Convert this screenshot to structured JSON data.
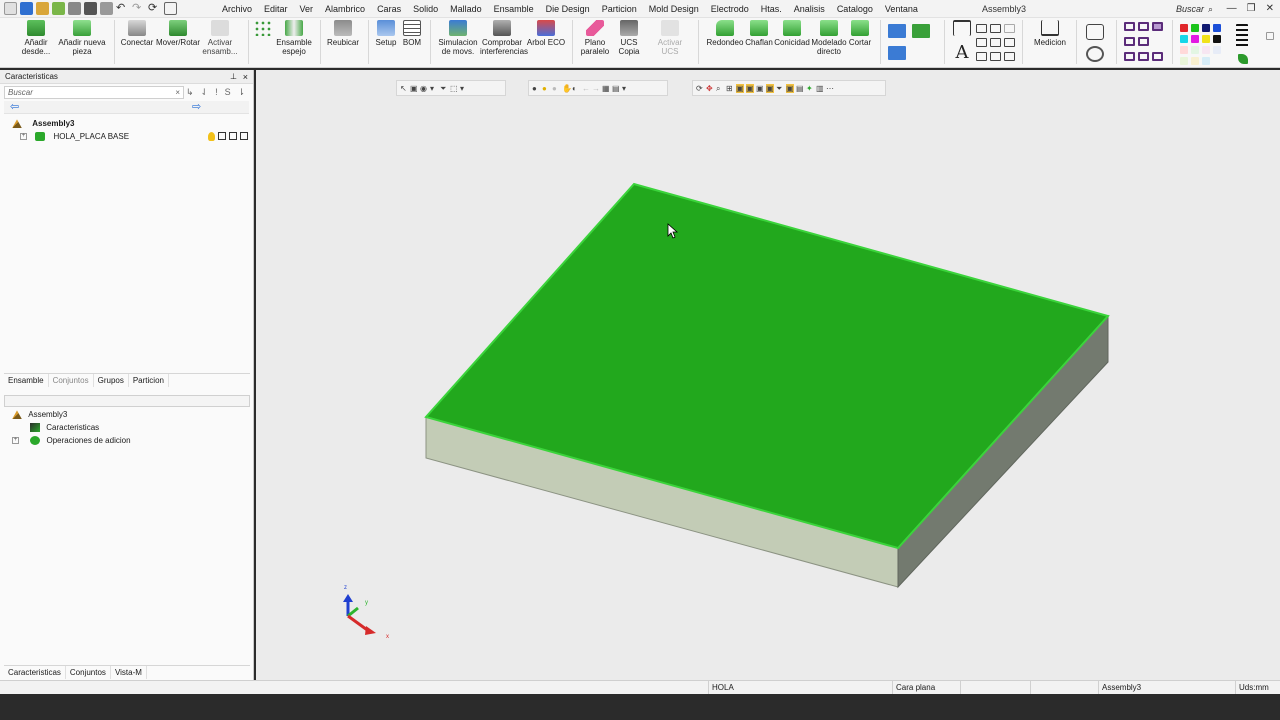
{
  "window": {
    "title": "Assembly3",
    "search_placeholder": "Buscar",
    "minimize": "—",
    "restore": "❐",
    "close": "✕"
  },
  "menu": [
    "Archivo",
    "Editar",
    "Ver",
    "Alambrico",
    "Caras",
    "Solido",
    "Mallado",
    "Ensamble",
    "Die Design",
    "Particion",
    "Mold Design",
    "Electrodo",
    "Htas.",
    "Analisis",
    "Catalogo",
    "Ventana"
  ],
  "ribbon": {
    "add_from": "Añadir\ndesde...",
    "add_new_part": "Añadir nueva\npieza",
    "connect": "Conectar",
    "move_rotate": "Mover/Rotar",
    "activate_assembly": "Activar\nensamb...",
    "mirror_assembly": "Ensamble\nespejo",
    "relocate": "Reubicar",
    "setup": "Setup",
    "bom": "BOM",
    "motion_sim": "Simulacion\nde movs.",
    "check_interference": "Comprobar\ninterferencias",
    "eco_tree": "Arbol ECO",
    "parallel_plane": "Plano\nparalelo",
    "ucs_copy": "UCS Copia",
    "activate_ucs": "Activar UCS",
    "fillet": "Redondeo",
    "chamfer": "Chaflan",
    "taper": "Conicidad",
    "direct_modeling": "Modelado\ndirecto",
    "cut": "Cortar",
    "measure": "Medicion"
  },
  "panel": {
    "title": "Caracteristicas",
    "search_placeholder": "Buscar",
    "tree": {
      "root": "Assembly3",
      "child": "HOLA_PLACA BASE"
    },
    "tabs": [
      "Ensamble",
      "Conjuntos",
      "Grupos",
      "Particion"
    ],
    "lower_tree": {
      "root": "Assembly3",
      "features": "Caracteristicas",
      "add_ops": "Operaciones de adicion"
    },
    "bottom_tabs": [
      "Caracteristicas",
      "Conjuntos",
      "Vista-M"
    ]
  },
  "status": {
    "part": "HOLA",
    "selection": "Cara plana",
    "assembly": "Assembly3",
    "units": "Uds:mm"
  },
  "axes": {
    "x": "x",
    "y": "y",
    "z": "z"
  },
  "colors": {
    "plate_top": "#22a81d",
    "plate_front": "#c3ccb6",
    "plate_side": "#737a6f",
    "viewport_bg": "#ebebeb",
    "axis_x": "#d62a2a",
    "axis_y": "#2db52d",
    "axis_z": "#1f3fd0"
  }
}
